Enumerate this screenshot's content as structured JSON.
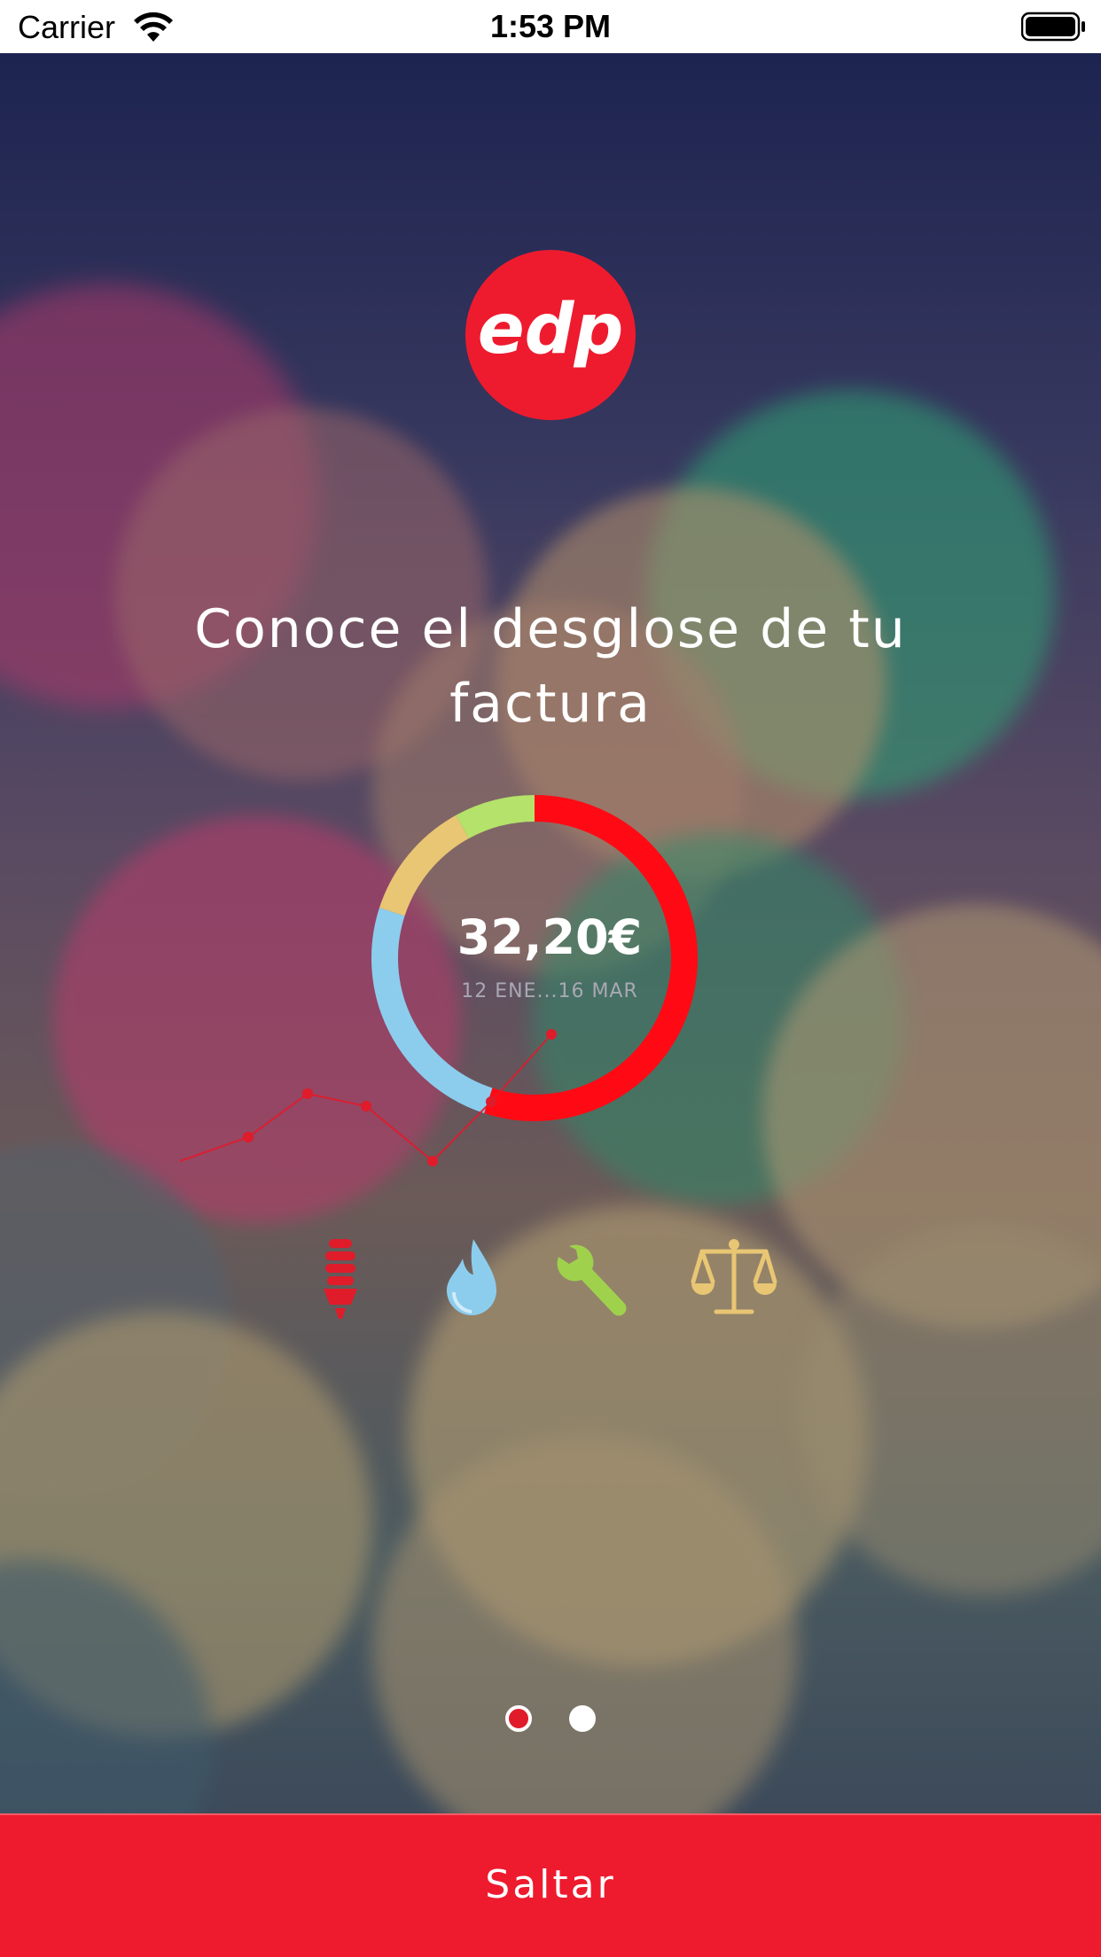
{
  "status_bar": {
    "carrier": "Carrier",
    "time": "1:53 PM",
    "wifi_icon": "wifi-icon",
    "battery_icon": "battery-icon"
  },
  "logo": {
    "text": "edp",
    "color": "#ee1b2e"
  },
  "headline": "Conoce el desglose de tu factura",
  "summary": {
    "amount": "32,20€",
    "period": "12 ENE...16 MAR"
  },
  "breakdown_ring": {
    "segments": [
      {
        "color": "#ff0a14",
        "fraction": 0.55
      },
      {
        "color": "#8ccdee",
        "fraction": 0.25
      },
      {
        "color": "#e8c673",
        "fraction": 0.12
      },
      {
        "color": "#b4e26a",
        "fraction": 0.08
      }
    ]
  },
  "categories": [
    {
      "icon": "lightbulb-icon",
      "color": "#e01b2a"
    },
    {
      "icon": "water-drop-icon",
      "color": "#8ccdee"
    },
    {
      "icon": "wrench-icon",
      "color": "#9fd14d"
    },
    {
      "icon": "scale-icon",
      "color": "#e8c673"
    }
  ],
  "pagination": {
    "total": 2,
    "current": 0
  },
  "skip_button": {
    "label": "Saltar"
  },
  "colors": {
    "accent": "#ee1a2e",
    "text": "#ffffff"
  }
}
